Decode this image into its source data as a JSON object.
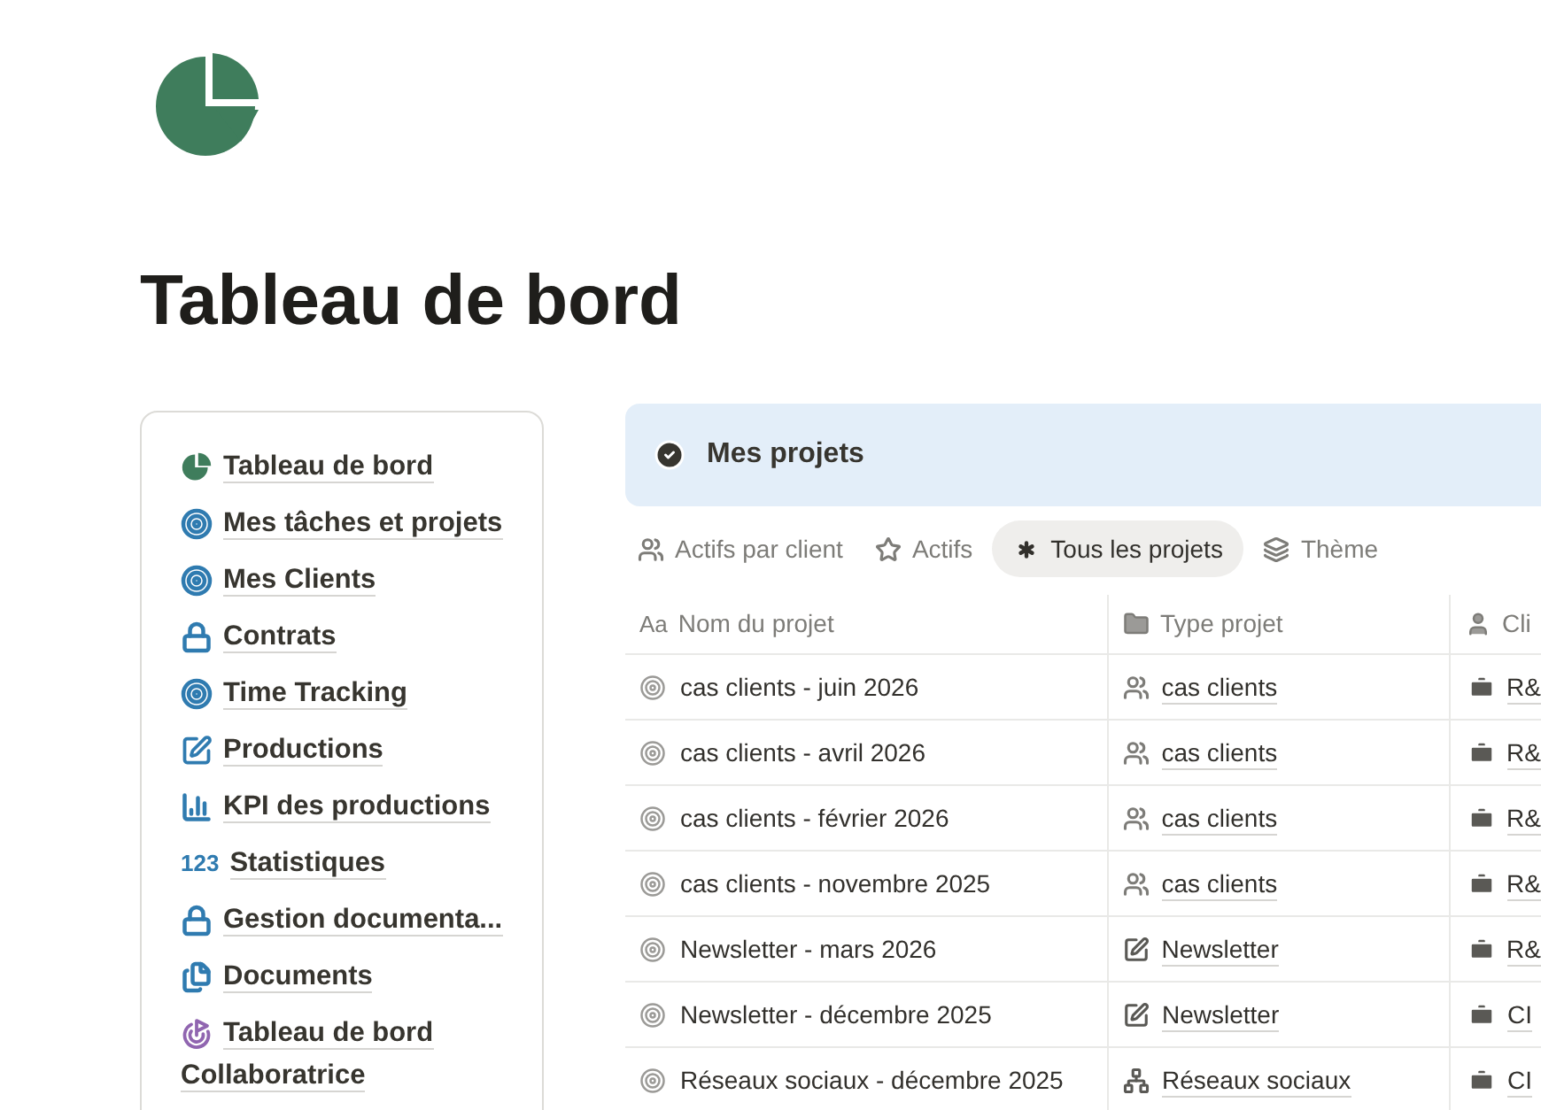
{
  "page": {
    "title": "Tableau de bord"
  },
  "sidebar": {
    "items": [
      {
        "label": "Tableau de bord",
        "kind": "pie"
      },
      {
        "label": "Mes tâches et projets",
        "kind": "target"
      },
      {
        "label": "Mes Clients",
        "kind": "target"
      },
      {
        "label": "Contrats",
        "kind": "lock"
      },
      {
        "label": "Time Tracking",
        "kind": "target"
      },
      {
        "label": "Productions",
        "kind": "edit"
      },
      {
        "label": "KPI des productions",
        "kind": "bars"
      },
      {
        "label": "Statistiques",
        "kind": "numbers",
        "glyph": "123"
      },
      {
        "label": "Gestion documenta...",
        "kind": "lock"
      },
      {
        "label": "Documents",
        "kind": "docs"
      },
      {
        "label": "Tableau de bord Collaboratrice",
        "kind": "goal"
      }
    ]
  },
  "view": {
    "title": "Mes projets",
    "tabs": [
      {
        "label": "Actifs par client",
        "kind": "people",
        "selected": false
      },
      {
        "label": "Actifs",
        "kind": "star",
        "selected": false
      },
      {
        "label": "Tous les projets",
        "kind": "asterisk",
        "selected": true
      },
      {
        "label": "Thème",
        "kind": "stack",
        "selected": false
      }
    ],
    "columns": [
      {
        "label": "Nom du projet",
        "kind": "text",
        "glyph": "Aa"
      },
      {
        "label": "Type projet",
        "kind": "folder"
      },
      {
        "label": "Cli",
        "kind": "person"
      }
    ],
    "rows": [
      {
        "name": "cas clients - juin 2026",
        "type": {
          "label": "cas clients",
          "kind": "people"
        },
        "client": "R&"
      },
      {
        "name": "cas clients - avril 2026",
        "type": {
          "label": "cas clients",
          "kind": "people"
        },
        "client": "R&"
      },
      {
        "name": "cas clients - février 2026",
        "type": {
          "label": "cas clients",
          "kind": "people"
        },
        "client": "R&"
      },
      {
        "name": "cas clients - novembre 2025",
        "type": {
          "label": "cas clients",
          "kind": "people"
        },
        "client": "R&"
      },
      {
        "name": "Newsletter - mars 2026",
        "type": {
          "label": "Newsletter",
          "kind": "edit"
        },
        "client": "R&"
      },
      {
        "name": "Newsletter - décembre 2025",
        "type": {
          "label": "Newsletter",
          "kind": "edit"
        },
        "client": "CI"
      },
      {
        "name": "Réseaux sociaux - décembre 2025",
        "type": {
          "label": "Réseaux sociaux",
          "kind": "network"
        },
        "client": "CI"
      }
    ]
  }
}
